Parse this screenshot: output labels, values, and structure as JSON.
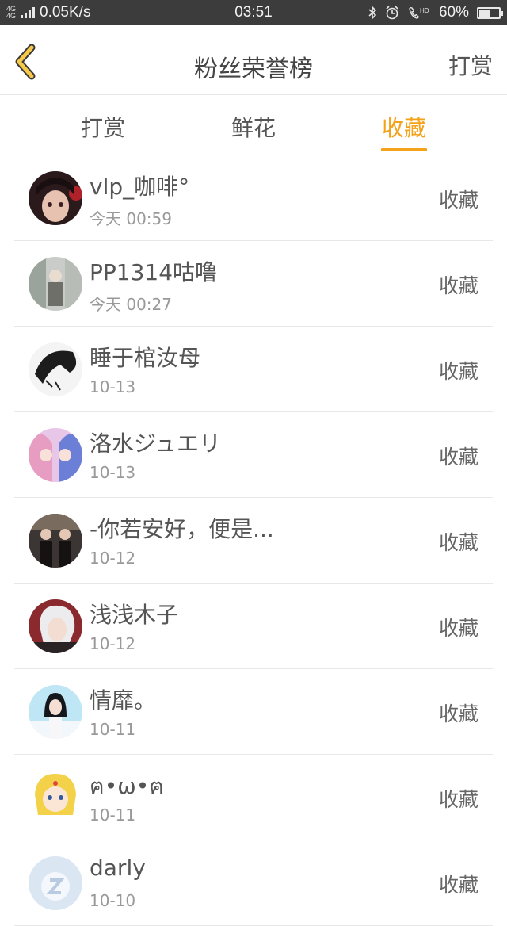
{
  "status_bar": {
    "network": "4G 4G",
    "speed": "0.05K/s",
    "time": "03:51",
    "icons": [
      "bluetooth-icon",
      "alarm-icon",
      "hd-call-icon"
    ],
    "battery": "60%",
    "battery_level": 0.6
  },
  "header": {
    "title": "粉丝荣誉榜",
    "action": "打赏",
    "back_icon": "chevron-left-icon",
    "accent": "#f5a21b"
  },
  "tabs": [
    {
      "label": "打赏",
      "active": false
    },
    {
      "label": "鲜花",
      "active": false
    },
    {
      "label": "收藏",
      "active": true
    }
  ],
  "list": [
    {
      "name": "vlp_咖啡°",
      "date": "今天 00:59",
      "action": "收藏"
    },
    {
      "name": "PP1314咕噜",
      "date": "今天 00:27",
      "action": "收藏"
    },
    {
      "name": "睡于棺汝母",
      "date": "10-13",
      "action": "收藏"
    },
    {
      "name": "洛水ジュエリ",
      "date": "10-13",
      "action": "收藏"
    },
    {
      "name": "-你若安好，便是...",
      "date": "10-12",
      "action": "收藏"
    },
    {
      "name": "浅浅木子",
      "date": "10-12",
      "action": "收藏"
    },
    {
      "name": "情靡。",
      "date": "10-11",
      "action": "收藏"
    },
    {
      "name": "ฅ•ω•ฅ",
      "date": "10-11",
      "action": "收藏"
    },
    {
      "name": "darly",
      "date": "10-10",
      "action": "收藏"
    }
  ]
}
